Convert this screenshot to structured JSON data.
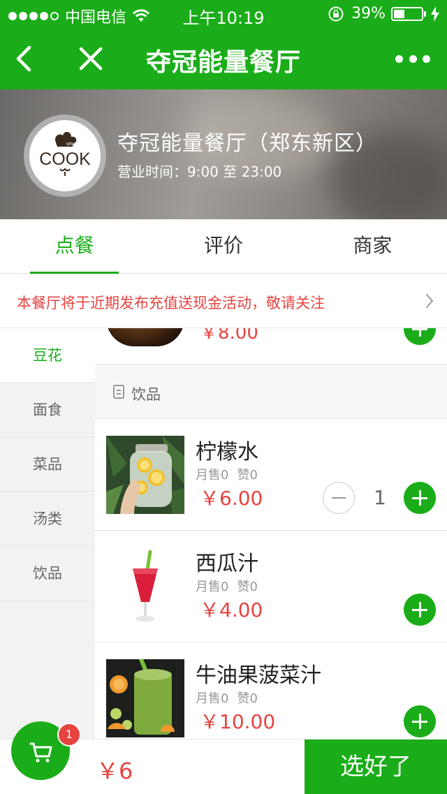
{
  "status_bar": {
    "carrier": "中国电信",
    "time": "上午10:19",
    "battery_percent": "39%",
    "battery_level": 0.39,
    "signal_bars_filled": 4,
    "signal_bars_total": 5
  },
  "navbar": {
    "title": "夺冠能量餐厅"
  },
  "restaurant": {
    "name": "夺冠能量餐厅（郑东新区）",
    "hours": "营业时间：9:00 至 23:00",
    "logo_text_top": "smart",
    "logo_text_main": "COOK"
  },
  "tabs": [
    {
      "label": "点餐",
      "active": true
    },
    {
      "label": "评价",
      "active": false
    },
    {
      "label": "商家",
      "active": false
    }
  ],
  "notice": {
    "text": "本餐厅将于近期发布充值送现金活动，敬请关注"
  },
  "sidebar": {
    "items": [
      {
        "label": "豆花",
        "active": true
      },
      {
        "label": "面食",
        "active": false
      },
      {
        "label": "菜品",
        "active": false
      },
      {
        "label": "汤类",
        "active": false
      },
      {
        "label": "饮品",
        "active": false
      }
    ]
  },
  "menu": {
    "partial_item": {
      "price": "￥8.00"
    },
    "section": {
      "label": "饮品"
    },
    "items": [
      {
        "name": "柠檬水",
        "sales": "月售0",
        "likes": "赞0",
        "price": "￥6.00",
        "quantity": "1"
      },
      {
        "name": "西瓜汁",
        "sales": "月售0",
        "likes": "赞0",
        "price": "￥4.00"
      },
      {
        "name": "牛油果菠菜汁",
        "sales": "月售0",
        "likes": "赞0",
        "price": "￥10.00"
      }
    ]
  },
  "cart": {
    "badge_count": "1",
    "total": "￥6",
    "checkout_label": "选好了"
  },
  "colors": {
    "brand_green": "#1aad19",
    "price_red": "#e64340"
  },
  "icons": {
    "back": "chevron-left-icon",
    "close": "close-icon",
    "more": "more-dots-icon",
    "wifi": "wifi-icon",
    "lock_rotation": "rotation-lock-icon",
    "charging": "charging-bolt-icon",
    "notice_arrow": "chevron-right-icon",
    "section": "menu-list-icon",
    "cart": "shopping-cart-icon"
  }
}
